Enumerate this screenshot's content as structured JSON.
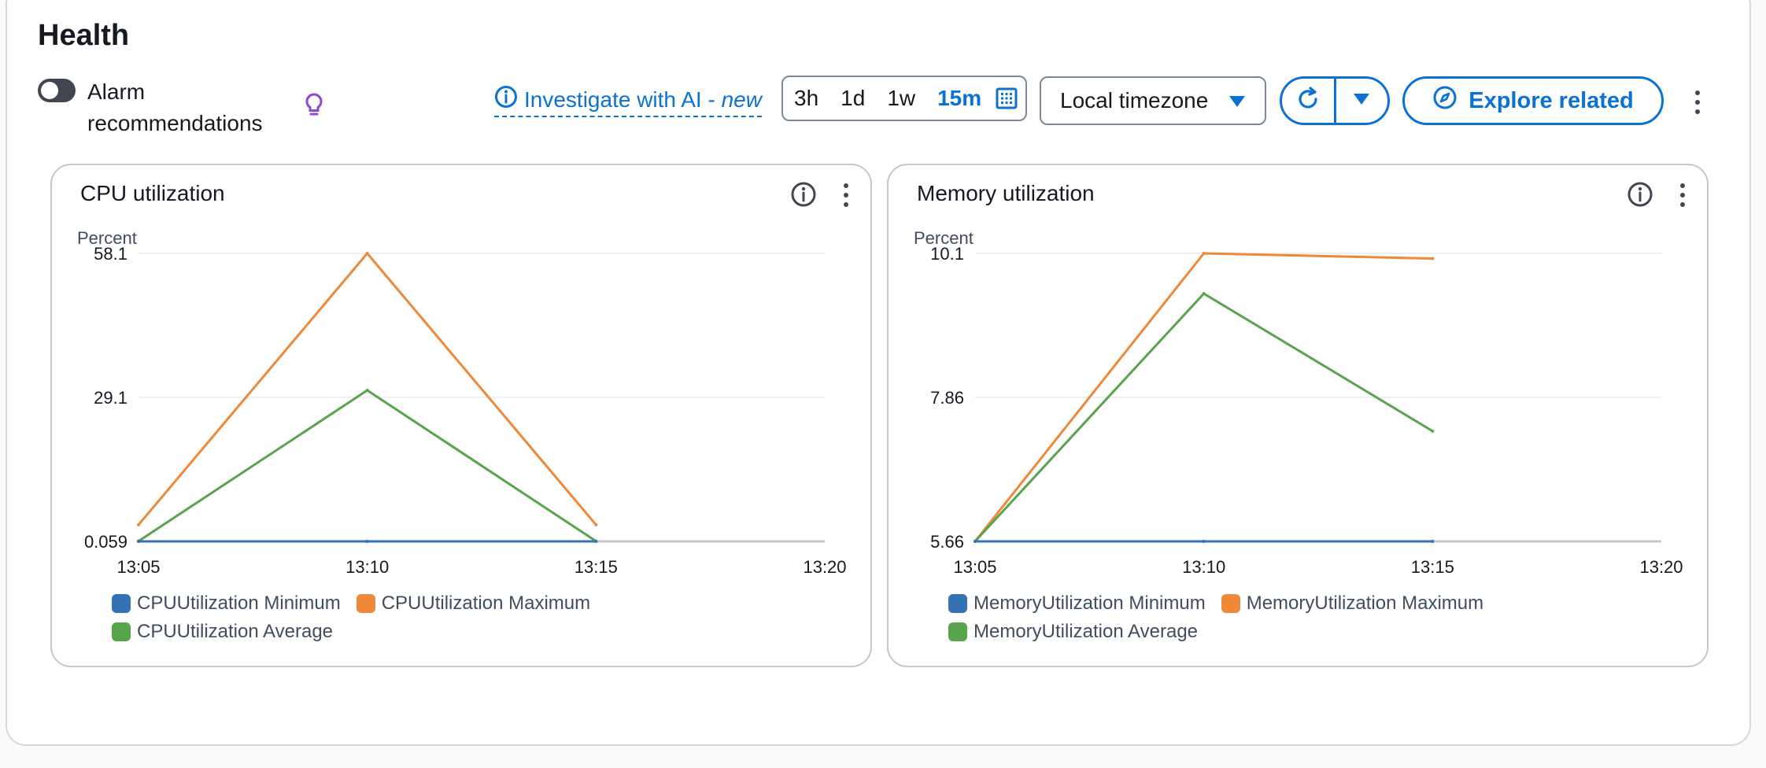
{
  "panel": {
    "title": "Health",
    "alarm_toggle_label": "Alarm recommendations",
    "investigate_label": "Investigate with AI - ",
    "investigate_new": "new",
    "ranges": [
      "3h",
      "1d",
      "1w",
      "15m"
    ],
    "selected_range": "15m",
    "timezone": "Local timezone",
    "explore_label": "Explore related"
  },
  "colors": {
    "accent": "#0972d3",
    "minimum": "#3471b5",
    "maximum": "#ef8838",
    "average": "#57a44b"
  },
  "charts": [
    {
      "title": "CPU utilization",
      "unit_label": "Percent",
      "yticks": [
        "58.1",
        "29.1",
        "0.059"
      ],
      "xticks": [
        "13:05",
        "13:10",
        "13:15",
        "13:20"
      ],
      "legend": [
        "CPUUtilization Minimum",
        "CPUUtilization Maximum",
        "CPUUtilization Average"
      ]
    },
    {
      "title": "Memory utilization",
      "unit_label": "Percent",
      "yticks": [
        "10.1",
        "7.86",
        "5.66"
      ],
      "xticks": [
        "13:05",
        "13:10",
        "13:15",
        "13:20"
      ],
      "legend": [
        "MemoryUtilization Minimum",
        "MemoryUtilization Maximum",
        "MemoryUtilization Average"
      ]
    }
  ],
  "chart_data": [
    {
      "type": "line",
      "title": "CPU utilization",
      "ylabel": "Percent",
      "x": [
        "13:05",
        "13:10",
        "13:15"
      ],
      "x_axis": [
        "13:05",
        "13:10",
        "13:15",
        "13:20"
      ],
      "ylim": [
        0.059,
        58.1
      ],
      "series": [
        {
          "name": "CPUUtilization Minimum",
          "values": [
            0.059,
            0.059,
            0.059
          ]
        },
        {
          "name": "CPUUtilization Maximum",
          "values": [
            3.4,
            58.1,
            3.4
          ]
        },
        {
          "name": "CPUUtilization Average",
          "values": [
            0.1,
            30.5,
            0.1
          ]
        }
      ],
      "grid": true,
      "legend": "bottom"
    },
    {
      "type": "line",
      "title": "Memory utilization",
      "ylabel": "Percent",
      "x": [
        "13:05",
        "13:10",
        "13:15"
      ],
      "x_axis": [
        "13:05",
        "13:10",
        "13:15",
        "13:20"
      ],
      "ylim": [
        5.66,
        10.1
      ],
      "series": [
        {
          "name": "MemoryUtilization Minimum",
          "values": [
            5.66,
            5.66,
            5.66
          ]
        },
        {
          "name": "MemoryUtilization Maximum",
          "values": [
            5.66,
            10.1,
            10.02
          ]
        },
        {
          "name": "MemoryUtilization Average",
          "values": [
            5.66,
            9.48,
            7.36
          ]
        }
      ],
      "grid": true,
      "legend": "bottom"
    }
  ]
}
